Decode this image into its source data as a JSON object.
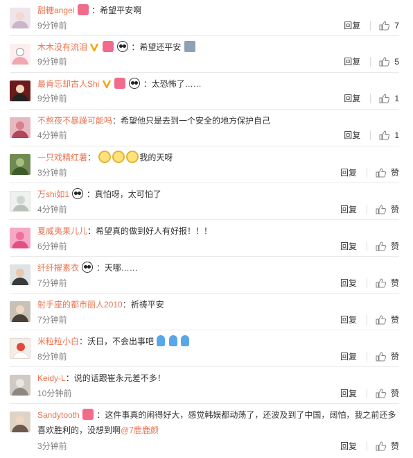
{
  "reply_label": "回复",
  "like_default_label": "赞",
  "comments": [
    {
      "user": "甜糖angel",
      "text": "：希望平安啊",
      "time": "9分钟前",
      "likes": "7"
    },
    {
      "user": "木木没有流泪",
      "text": "：希望还平安",
      "time": "9分钟前",
      "likes": "5"
    },
    {
      "user": "最肯忘却古人Shi",
      "text": "：太恐怖了……",
      "time": "9分钟前",
      "likes": "1"
    },
    {
      "user": "不熬夜不暴躁可能吗",
      "text": "：希望他只是去到一个安全的地方保护自己",
      "time": "4分钟前",
      "likes": "1"
    },
    {
      "user": "一只戏精红薯",
      "text": "：",
      "text2": "我的天呀",
      "time": "3分钟前",
      "likes": "赞"
    },
    {
      "user": "万shi如1",
      "text": "：真怕呀，太可怕了",
      "time": "4分钟前",
      "likes": "赞"
    },
    {
      "user": "夏威夷果儿儿",
      "text": "：希望真的做到好人有好报！！！",
      "time": "6分钟前",
      "likes": "赞"
    },
    {
      "user": "纤纤擢素衣",
      "text": "：天哪……",
      "time": "7分钟前",
      "likes": "赞"
    },
    {
      "user": "射手座的都市丽人2010",
      "text": "：祈祷平安",
      "time": "7分钟前",
      "likes": "赞"
    },
    {
      "user": "米粒粒小白",
      "text": "：沃日，不会出事吧",
      "time": "8分钟前",
      "likes": "赞"
    },
    {
      "user": "Keidy-L",
      "text": "：说的话跟崔永元差不多！",
      "time": "10分钟前",
      "likes": "赞"
    },
    {
      "user": "Sandytooth",
      "text": "：这件事真的闹得好大，感觉韩娱都动荡了，还波及到了中国，阔怕，我之前还多喜欢胜利的，没想到啊",
      "mention": "@7鹿鹿颜",
      "time": "3分钟前",
      "likes": "赞"
    }
  ],
  "colors": {
    "username": "#eb7350",
    "time": "#808080",
    "divider": "#eaeaea"
  }
}
